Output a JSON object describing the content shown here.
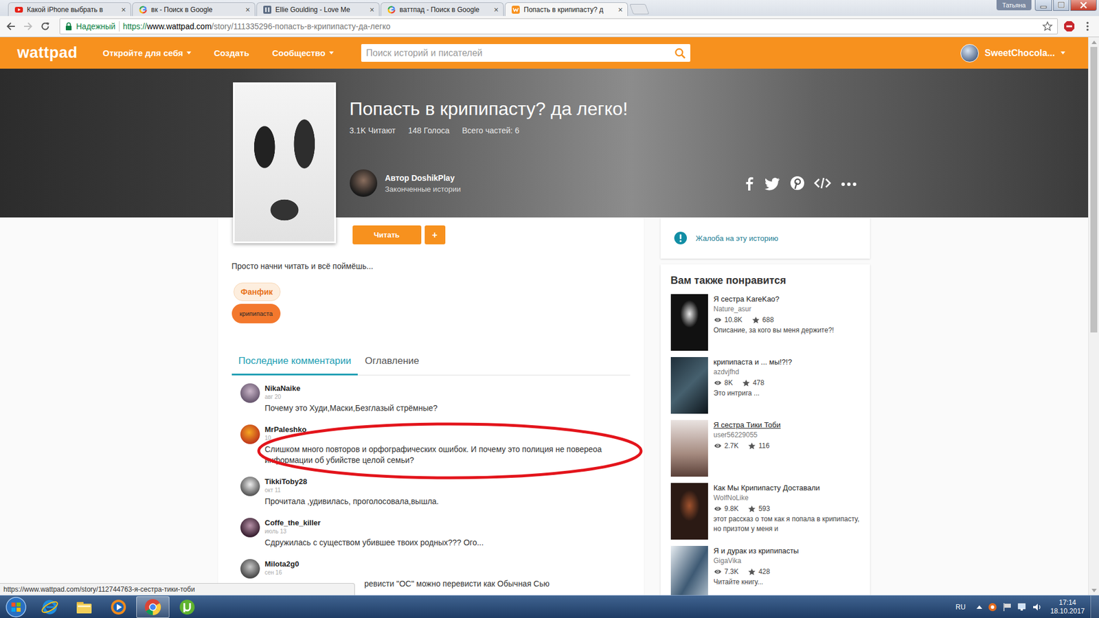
{
  "browser": {
    "tabs": [
      {
        "title": "Какой iPhone выбрать в",
        "kind": "youtube",
        "selected": false
      },
      {
        "title": "вк - Поиск в Google",
        "kind": "google",
        "selected": false
      },
      {
        "title": "Ellie Goulding - Love Me",
        "kind": "site",
        "selected": false
      },
      {
        "title": "ваттпад - Поиск в Google",
        "kind": "google",
        "selected": false
      },
      {
        "title": "Попасть в крипипасту? д",
        "kind": "wattpad",
        "selected": true
      }
    ],
    "tab_close": "×",
    "profile": "Татьяна",
    "security": "Надежный",
    "url": {
      "scheme": "https://",
      "host": "www.wattpad.com",
      "path": "/story/111335296-попасть-в-крипипасту-да-легко"
    },
    "can_go_forward": false,
    "status_url": "https://www.wattpad.com/story/112744763-я-сестра-тики-тоби",
    "scrollbar": {
      "level": 0.53
    }
  },
  "header": {
    "logo": "wattpad",
    "nav": [
      {
        "label": "Откройте для себя",
        "has_menu": true
      },
      {
        "label": "Создать",
        "has_menu": false
      },
      {
        "label": "Сообщество",
        "has_menu": true
      }
    ],
    "search_placeholder": "Поиск историй и писателей",
    "user": "SweetChocola..."
  },
  "story": {
    "title": "Попасть в крипипасту? да легко!",
    "stats": [
      "3.1K Читают",
      "148 Голоса",
      "Всего частей: 6"
    ],
    "author": "Автор DoshikPlay",
    "author_note": "Законченные истории",
    "read_button": "Читать",
    "add_button": "+",
    "description": "Просто начни читать и всё поймёшь...",
    "tags": [
      {
        "label": "Фанфик",
        "kind": "category"
      },
      {
        "label": "крипипаста",
        "kind": "tag"
      }
    ]
  },
  "tabs": [
    {
      "label": "Последние комментарии",
      "selected": true
    },
    {
      "label": "Оглавление",
      "selected": false
    }
  ],
  "comments": [
    {
      "author": "NikaNaike",
      "date": "авг 20",
      "text": "Почему это Худи,Маски,Безглазый стрёмные?",
      "highlighted": false,
      "clipped": false
    },
    {
      "author": "MrPaleshko",
      "date": "10",
      "text": "Слишком много повторов и орфографических ошибок. И почему это полиция не повереоа информации об убийстве целой семьи?",
      "highlighted": true,
      "clipped": false
    },
    {
      "author": "TikkiToby28",
      "date": "окт 11",
      "text": "Прочитала ,удивилась, проголосовала,вышла.",
      "highlighted": false,
      "clipped": false
    },
    {
      "author": "Coffe_the_killer",
      "date": "июль 13",
      "text": "Сдружилась с существом убившее твоих родных??? Ого...",
      "highlighted": false,
      "clipped": false
    },
    {
      "author": "Milota2g0",
      "date": "сен 16",
      "text": "ревисти \"ОС\" можно перевисти как Обычная Сью",
      "highlighted": false,
      "clipped": true
    }
  ],
  "report": "Жалоба на эту историю",
  "recommendations": {
    "title": "Вам также понравится",
    "items": [
      {
        "title": "Я сестра KareKao?",
        "author": "Nature_asur",
        "reads": "10.8K",
        "votes": "688",
        "description": "Описание, за кого вы меня держите?!",
        "hovered": false
      },
      {
        "title": "крипипаста и ... мы!?!?",
        "author": "azdvjfhd",
        "reads": "8K",
        "votes": "478",
        "description": "Это интрига ...",
        "hovered": false
      },
      {
        "title": "Я сестра Тики Тоби",
        "author": "user56229055",
        "reads": "2.7K",
        "votes": "116",
        "description": "",
        "hovered": true
      },
      {
        "title": "Как Мы Крипипасту Доставали",
        "author": "WolfNoLike",
        "reads": "9.8K",
        "votes": "593",
        "description": "этот рассказ о том как я попала в крипипасту, но призтом у меня и",
        "hovered": false
      },
      {
        "title": "Я и дурак из крипипасты",
        "author": "GigaVika",
        "reads": "7.3K",
        "votes": "428",
        "description": "Читайте книгу...",
        "hovered": false
      }
    ]
  },
  "taskbar": {
    "apps": [
      {
        "kind": "ie",
        "active": false
      },
      {
        "kind": "explorer",
        "active": false
      },
      {
        "kind": "media",
        "active": false
      },
      {
        "kind": "chrome",
        "active": true
      },
      {
        "kind": "utorrent",
        "active": false
      }
    ],
    "language": "RU",
    "time": "17:14",
    "date": "18.10.2017"
  }
}
